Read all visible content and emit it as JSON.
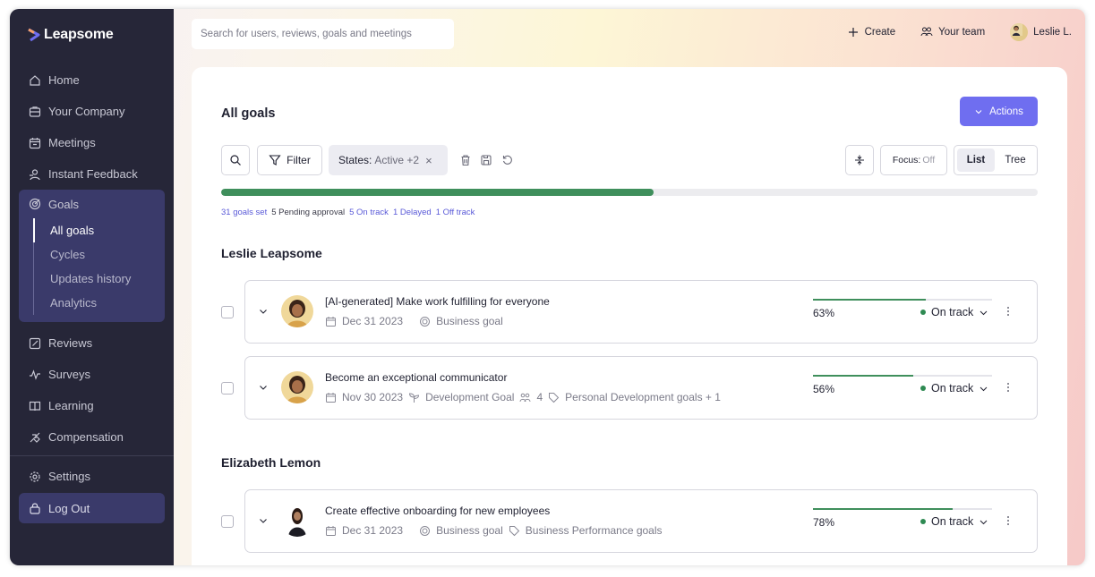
{
  "brand": {
    "name": "Leapsome"
  },
  "sidebar": {
    "items": [
      {
        "label": "Home",
        "icon": "home-icon"
      },
      {
        "label": "Your Company",
        "icon": "company-icon"
      },
      {
        "label": "Meetings",
        "icon": "meetings-icon"
      },
      {
        "label": "Instant Feedback",
        "icon": "feedback-icon"
      }
    ],
    "goals": {
      "label": "Goals",
      "icon": "goals-icon",
      "sub": [
        "All goals",
        "Cycles",
        "Updates history",
        "Analytics"
      ]
    },
    "items_after": [
      {
        "label": "Reviews",
        "icon": "reviews-icon"
      },
      {
        "label": "Surveys",
        "icon": "surveys-icon"
      },
      {
        "label": "Learning",
        "icon": "learning-icon"
      },
      {
        "label": "Compensation",
        "icon": "compensation-icon"
      }
    ],
    "settings": "Settings",
    "logout": "Log Out"
  },
  "topbar": {
    "search_placeholder": "Search for users, reviews, goals and meetings",
    "create": "Create",
    "your_team": "Your team",
    "user": "Leslie L."
  },
  "page": {
    "title": "All goals",
    "actions": "Actions",
    "filter": "Filter",
    "chip_label": "States:",
    "chip_value": "Active +2",
    "focus_label": "Focus:",
    "focus_value": "Off",
    "view_list": "List",
    "view_tree": "Tree",
    "overall_progress": 0.53,
    "stats": {
      "goals_set": "31 goals set",
      "pending": "5 Pending approval",
      "on_track": "5 On track",
      "delayed": "1 Delayed",
      "off_track": "1 Off track"
    }
  },
  "groups": [
    {
      "owner": "Leslie Leapsome",
      "goals": [
        {
          "title": "[AI-generated] Make work fulfilling for everyone",
          "date": "Dec 31 2023",
          "type": "Business goal",
          "progress_label": "63%",
          "progress": 0.63,
          "status": "On track"
        },
        {
          "title": "Become an exceptional communicator",
          "date": "Nov 30 2023",
          "type": "Development Goal",
          "people": "4",
          "tags": "Personal Development goals + 1",
          "progress_label": "56%",
          "progress": 0.56,
          "status": "On track"
        }
      ]
    },
    {
      "owner": "Elizabeth Lemon",
      "goals": [
        {
          "title": "Create effective onboarding for new employees",
          "date": "Dec 31 2023",
          "type": "Business goal",
          "tags": "Business Performance goals",
          "progress_label": "78%",
          "progress": 0.78,
          "status": "On track"
        }
      ]
    }
  ],
  "colors": {
    "sidebar": "#262638",
    "accent": "#6f6ef0",
    "progress": "#3f8f5c",
    "on_track_dot": "#2e8a52"
  }
}
